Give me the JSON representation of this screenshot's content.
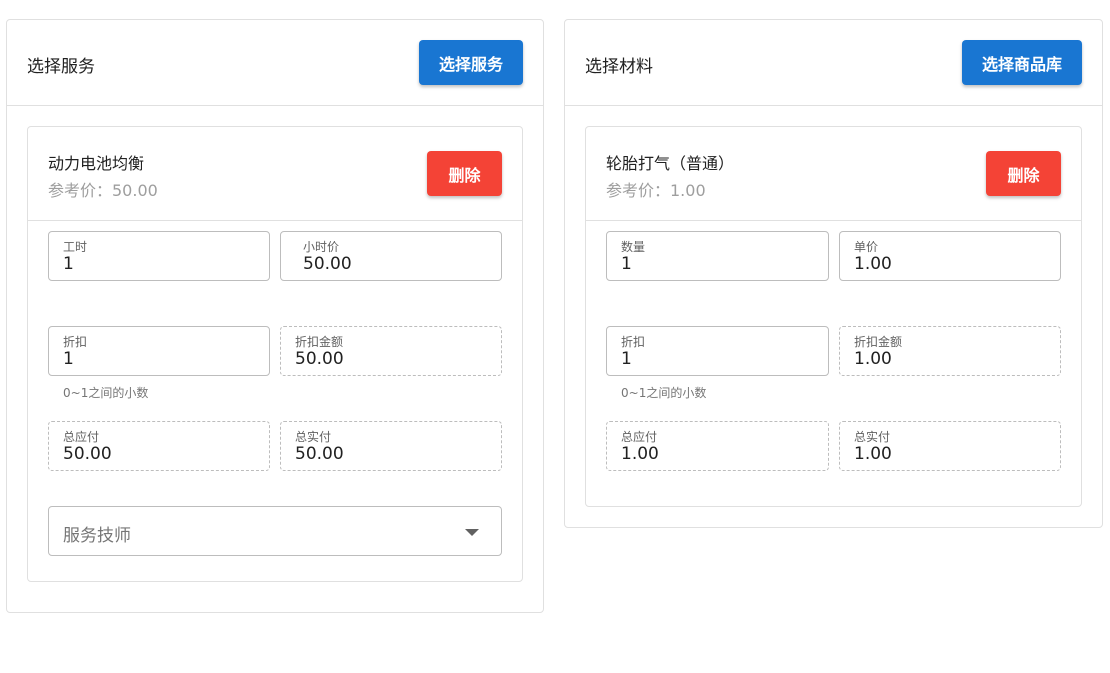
{
  "service_panel": {
    "title": "选择服务",
    "button_label": "选择服务",
    "item": {
      "name": "动力电池均衡",
      "reference_price": "参考价：50.00",
      "delete_label": "删除",
      "hours": {
        "label": "工时",
        "value": "1"
      },
      "hourly_price": {
        "label": "小时价",
        "value": "50.00"
      },
      "discount": {
        "label": "折扣",
        "value": "1",
        "hint": "0~1之间的小数"
      },
      "discount_amount": {
        "label": "折扣金额",
        "value": "50.00"
      },
      "total_payable": {
        "label": "总应付",
        "value": "50.00"
      },
      "total_paid": {
        "label": "总实付",
        "value": "50.00"
      },
      "technician": {
        "placeholder": "服务技师"
      }
    }
  },
  "material_panel": {
    "title": "选择材料",
    "button_label": "选择商品库",
    "item": {
      "name": "轮胎打气（普通）",
      "reference_price": "参考价：1.00",
      "delete_label": "删除",
      "quantity": {
        "label": "数量",
        "value": "1"
      },
      "unit_price": {
        "label": "单价",
        "value": "1.00"
      },
      "discount": {
        "label": "折扣",
        "value": "1",
        "hint": "0~1之间的小数"
      },
      "discount_amount": {
        "label": "折扣金额",
        "value": "1.00"
      },
      "total_payable": {
        "label": "总应付",
        "value": "1.00"
      },
      "total_paid": {
        "label": "总实付",
        "value": "1.00"
      }
    }
  },
  "colors": {
    "primary": "#1976d2",
    "danger": "#f44336",
    "border": "#e0e0e0",
    "muted_text": "#9e9e9e"
  }
}
